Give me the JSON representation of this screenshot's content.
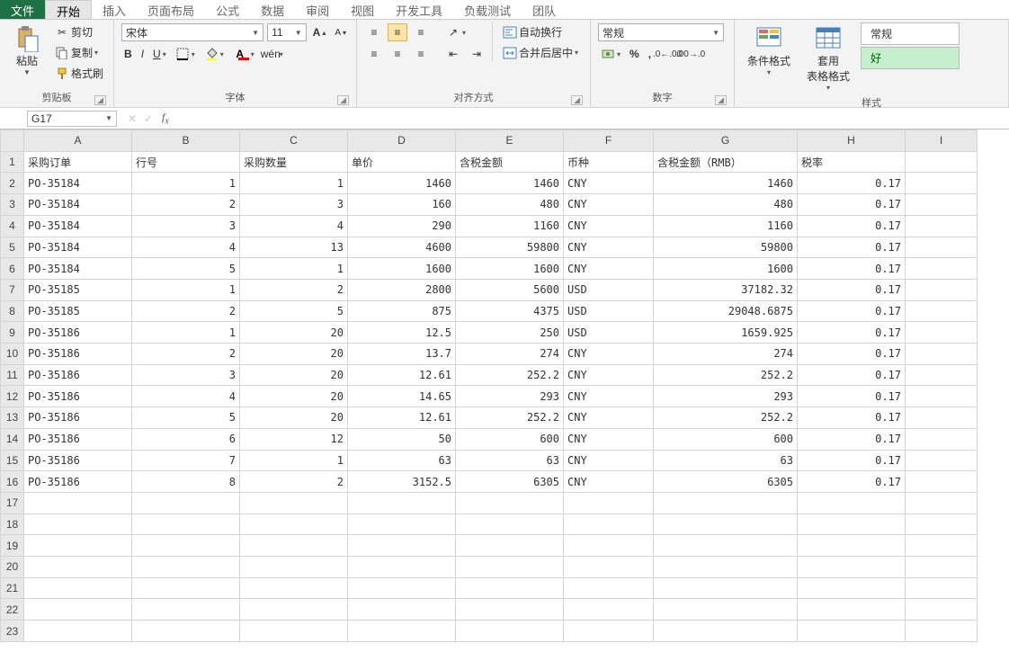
{
  "tabs": {
    "file": "文件",
    "items": [
      "开始",
      "插入",
      "页面布局",
      "公式",
      "数据",
      "审阅",
      "视图",
      "开发工具",
      "负载测试",
      "团队"
    ],
    "active": "开始"
  },
  "ribbon": {
    "clipboard": {
      "paste": "粘贴",
      "cut": "剪切",
      "copy": "复制",
      "format_painter": "格式刷",
      "title": "剪贴板"
    },
    "font": {
      "title": "字体",
      "name": "宋体",
      "size": "11",
      "bold": "B",
      "italic": "I",
      "underline": "U"
    },
    "align": {
      "title": "对齐方式",
      "wrap": "自动换行",
      "merge": "合并后居中"
    },
    "number": {
      "title": "数字",
      "format": "常规"
    },
    "styles": {
      "title": "样式",
      "cond": "条件格式",
      "table": "套用\n表格格式",
      "normal": "常规",
      "good": "好"
    }
  },
  "fbar": {
    "cellref": "G17",
    "formula": ""
  },
  "columns": [
    "A",
    "B",
    "C",
    "D",
    "E",
    "F",
    "G",
    "H",
    "I"
  ],
  "headers": [
    "采购订单",
    "行号",
    "采购数量",
    "单价",
    "含税金额",
    "币种",
    "含税金额（RMB）",
    "税率"
  ],
  "rows": [
    [
      "PO-35184",
      "1",
      "1",
      "1460",
      "1460",
      "CNY",
      "1460",
      "0.17"
    ],
    [
      "PO-35184",
      "2",
      "3",
      "160",
      "480",
      "CNY",
      "480",
      "0.17"
    ],
    [
      "PO-35184",
      "3",
      "4",
      "290",
      "1160",
      "CNY",
      "1160",
      "0.17"
    ],
    [
      "PO-35184",
      "4",
      "13",
      "4600",
      "59800",
      "CNY",
      "59800",
      "0.17"
    ],
    [
      "PO-35184",
      "5",
      "1",
      "1600",
      "1600",
      "CNY",
      "1600",
      "0.17"
    ],
    [
      "PO-35185",
      "1",
      "2",
      "2800",
      "5600",
      "USD",
      "37182.32",
      "0.17"
    ],
    [
      "PO-35185",
      "2",
      "5",
      "875",
      "4375",
      "USD",
      "29048.6875",
      "0.17"
    ],
    [
      "PO-35186",
      "1",
      "20",
      "12.5",
      "250",
      "USD",
      "1659.925",
      "0.17"
    ],
    [
      "PO-35186",
      "2",
      "20",
      "13.7",
      "274",
      "CNY",
      "274",
      "0.17"
    ],
    [
      "PO-35186",
      "3",
      "20",
      "12.61",
      "252.2",
      "CNY",
      "252.2",
      "0.17"
    ],
    [
      "PO-35186",
      "4",
      "20",
      "14.65",
      "293",
      "CNY",
      "293",
      "0.17"
    ],
    [
      "PO-35186",
      "5",
      "20",
      "12.61",
      "252.2",
      "CNY",
      "252.2",
      "0.17"
    ],
    [
      "PO-35186",
      "6",
      "12",
      "50",
      "600",
      "CNY",
      "600",
      "0.17"
    ],
    [
      "PO-35186",
      "7",
      "1",
      "63",
      "63",
      "CNY",
      "63",
      "0.17"
    ],
    [
      "PO-35186",
      "8",
      "2",
      "3152.5",
      "6305",
      "CNY",
      "6305",
      "0.17"
    ]
  ],
  "blank_rows": 7,
  "col_align": [
    "txt",
    "num",
    "num",
    "num",
    "num",
    "txt",
    "num",
    "num",
    "txt"
  ]
}
